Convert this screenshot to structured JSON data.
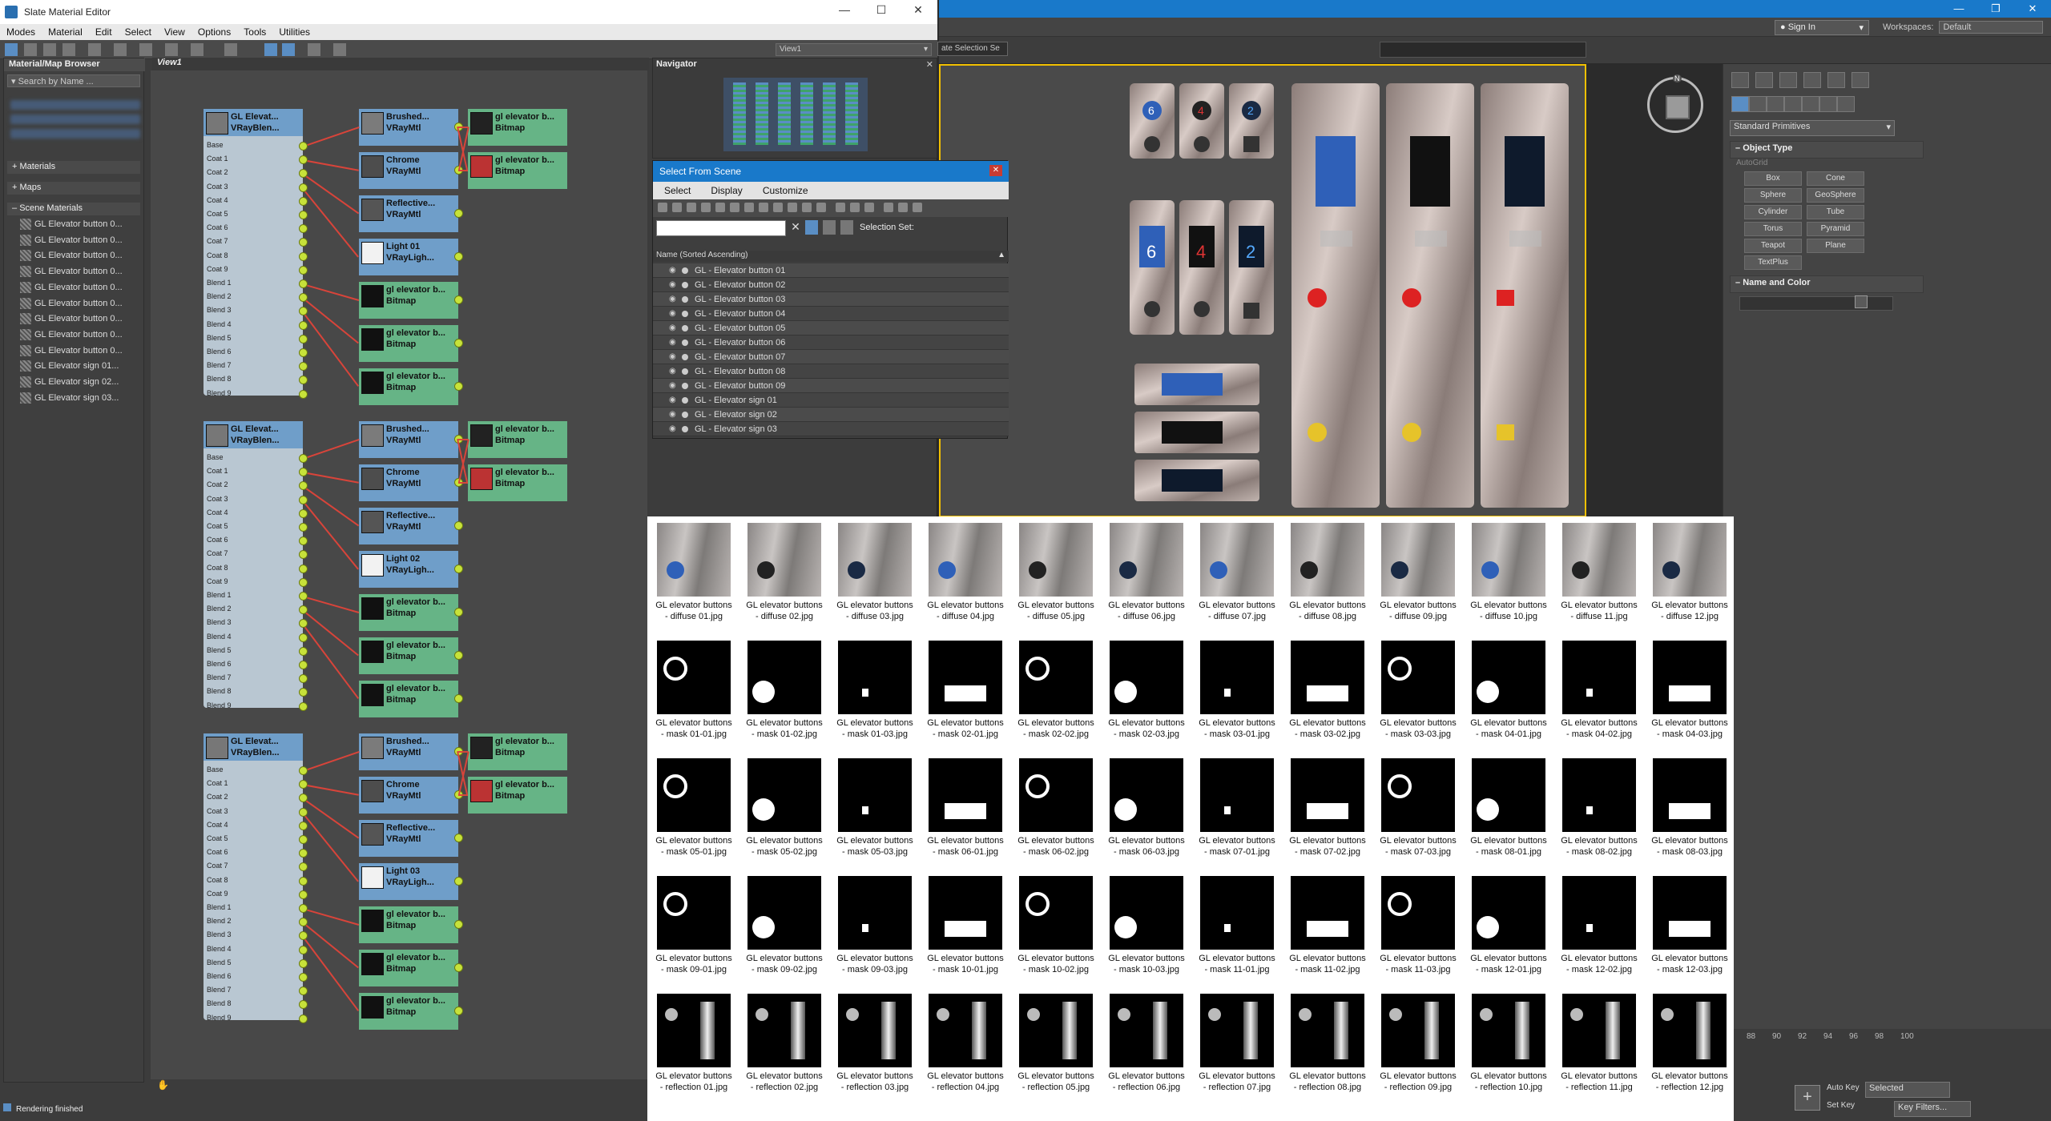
{
  "slate": {
    "title": "Slate Material Editor",
    "menu": [
      "Modes",
      "Material",
      "Edit",
      "Select",
      "View",
      "Options",
      "Tools",
      "Utilities"
    ],
    "view_dropdown": "View1",
    "browser": {
      "title": "Material/Map Browser",
      "search_placeholder": "Search by Name ...",
      "categories": [
        "Materials",
        "Maps",
        "Scene Materials"
      ],
      "scene_materials": [
        "GL Elevator button 0...",
        "GL Elevator button 0...",
        "GL Elevator button 0...",
        "GL Elevator button 0...",
        "GL Elevator button 0...",
        "GL Elevator button 0...",
        "GL Elevator button 0...",
        "GL Elevator button 0...",
        "GL Elevator button 0...",
        "GL Elevator sign 01...",
        "GL Elevator sign 02...",
        "GL Elevator sign 03..."
      ]
    },
    "view_tab": "View1",
    "slots": [
      "Base",
      "Coat 1",
      "Coat 2",
      "Coat 3",
      "Coat 4",
      "Coat 5",
      "Coat 6",
      "Coat 7",
      "Coat 8",
      "Coat 9",
      "Blend 1",
      "Blend 2",
      "Blend 3",
      "Blend 4",
      "Blend 5",
      "Blend 6",
      "Blend 7",
      "Blend 8",
      "Blend 9"
    ],
    "groups": [
      {
        "main": {
          "t1": "GL Elevat...",
          "t2": "VRayBlen..."
        },
        "mtls": [
          {
            "t1": "Brushed...",
            "t2": "VRayMtl"
          },
          {
            "t1": "Chrome",
            "t2": "VRayMtl"
          },
          {
            "t1": "Reflective...",
            "t2": "VRayMtl"
          },
          {
            "t1": "Light 01",
            "t2": "VRayLigh..."
          },
          {
            "t1": "gl elevator b...",
            "t2": "Bitmap"
          },
          {
            "t1": "gl elevator b...",
            "t2": "Bitmap"
          },
          {
            "t1": "gl elevator b...",
            "t2": "Bitmap"
          }
        ],
        "bitmaps": [
          {
            "t1": "gl elevator b...",
            "t2": "Bitmap"
          },
          {
            "t1": "gl elevator b...",
            "t2": "Bitmap"
          }
        ]
      },
      {
        "main": {
          "t1": "GL Elevat...",
          "t2": "VRayBlen..."
        },
        "mtls": [
          {
            "t1": "Brushed...",
            "t2": "VRayMtl"
          },
          {
            "t1": "Chrome",
            "t2": "VRayMtl"
          },
          {
            "t1": "Reflective...",
            "t2": "VRayMtl"
          },
          {
            "t1": "Light 02",
            "t2": "VRayLigh..."
          },
          {
            "t1": "gl elevator b...",
            "t2": "Bitmap"
          },
          {
            "t1": "gl elevator b...",
            "t2": "Bitmap"
          },
          {
            "t1": "gl elevator b...",
            "t2": "Bitmap"
          }
        ],
        "bitmaps": [
          {
            "t1": "gl elevator b...",
            "t2": "Bitmap"
          },
          {
            "t1": "gl elevator b...",
            "t2": "Bitmap"
          }
        ]
      },
      {
        "main": {
          "t1": "GL Elevat...",
          "t2": "VRayBlen..."
        },
        "mtls": [
          {
            "t1": "Brushed...",
            "t2": "VRayMtl"
          },
          {
            "t1": "Chrome",
            "t2": "VRayMtl"
          },
          {
            "t1": "Reflective...",
            "t2": "VRayMtl"
          },
          {
            "t1": "Light 03",
            "t2": "VRayLigh..."
          },
          {
            "t1": "gl elevator b...",
            "t2": "Bitmap"
          },
          {
            "t1": "gl elevator b...",
            "t2": "Bitmap"
          },
          {
            "t1": "gl elevator b...",
            "t2": "Bitmap"
          }
        ],
        "bitmaps": [
          {
            "t1": "gl elevator b...",
            "t2": "Bitmap"
          },
          {
            "t1": "gl elevator b...",
            "t2": "Bitmap"
          }
        ]
      }
    ],
    "status": "Rendering finished"
  },
  "navigator": {
    "title": "Navigator"
  },
  "select_from_scene": {
    "title": "Select From Scene",
    "menu": [
      "Select",
      "Display",
      "Customize"
    ],
    "selection_set_label": "Selection Set:",
    "column_header": "Name (Sorted Ascending)",
    "rows": [
      "GL - Elevator button 01",
      "GL - Elevator button 02",
      "GL - Elevator button 03",
      "GL - Elevator button 04",
      "GL - Elevator button 05",
      "GL - Elevator button 06",
      "GL - Elevator button 07",
      "GL - Elevator button 08",
      "GL - Elevator button 09",
      "GL - Elevator sign 01",
      "GL - Elevator sign 02",
      "GL - Elevator sign 03"
    ]
  },
  "max": {
    "sign_in": "Sign In",
    "workspaces_label": "Workspaces:",
    "workspaces_value": "Default",
    "selection_set": "ate Selection Se",
    "primitive_dropdown": "Standard Primitives",
    "object_type_title": "Object Type",
    "autogrid": "AutoGrid",
    "object_types": [
      "Box",
      "Cone",
      "Sphere",
      "GeoSphere",
      "Cylinder",
      "Tube",
      "Torus",
      "Pyramid",
      "Teapot",
      "Plane",
      "TextPlus"
    ],
    "name_color_title": "Name and Color",
    "timeline_ticks": [
      "88",
      "90",
      "92",
      "94",
      "96",
      "98",
      "100"
    ],
    "auto_key": "Auto Key",
    "set_key": "Set Key",
    "selected": "Selected",
    "key_filters": "Key Filters...",
    "viewcube_label": "N"
  },
  "textures": [
    [
      "GL elevator buttons - diffuse 01.jpg",
      "GL elevator buttons - diffuse 02.jpg",
      "GL elevator buttons - diffuse 03.jpg",
      "GL elevator buttons - diffuse 04.jpg",
      "GL elevator buttons - diffuse 05.jpg",
      "GL elevator buttons - diffuse 06.jpg",
      "GL elevator buttons - diffuse 07.jpg",
      "GL elevator buttons - diffuse 08.jpg",
      "GL elevator buttons - diffuse 09.jpg",
      "GL elevator buttons - diffuse 10.jpg",
      "GL elevator buttons - diffuse 11.jpg",
      "GL elevator buttons - diffuse 12.jpg"
    ],
    [
      "GL elevator buttons - mask 01-01.jpg",
      "GL elevator buttons - mask 01-02.jpg",
      "GL elevator buttons - mask 01-03.jpg",
      "GL elevator buttons - mask 02-01.jpg",
      "GL elevator buttons - mask 02-02.jpg",
      "GL elevator buttons - mask 02-03.jpg",
      "GL elevator buttons - mask 03-01.jpg",
      "GL elevator buttons - mask 03-02.jpg",
      "GL elevator buttons - mask 03-03.jpg",
      "GL elevator buttons - mask 04-01.jpg",
      "GL elevator buttons - mask 04-02.jpg",
      "GL elevator buttons - mask 04-03.jpg"
    ],
    [
      "GL elevator buttons - mask 05-01.jpg",
      "GL elevator buttons - mask 05-02.jpg",
      "GL elevator buttons - mask 05-03.jpg",
      "GL elevator buttons - mask 06-01.jpg",
      "GL elevator buttons - mask 06-02.jpg",
      "GL elevator buttons - mask 06-03.jpg",
      "GL elevator buttons - mask 07-01.jpg",
      "GL elevator buttons - mask 07-02.jpg",
      "GL elevator buttons - mask 07-03.jpg",
      "GL elevator buttons - mask 08-01.jpg",
      "GL elevator buttons - mask 08-02.jpg",
      "GL elevator buttons - mask 08-03.jpg"
    ],
    [
      "GL elevator buttons - mask 09-01.jpg",
      "GL elevator buttons - mask 09-02.jpg",
      "GL elevator buttons - mask 09-03.jpg",
      "GL elevator buttons - mask 10-01.jpg",
      "GL elevator buttons - mask 10-02.jpg",
      "GL elevator buttons - mask 10-03.jpg",
      "GL elevator buttons - mask 11-01.jpg",
      "GL elevator buttons - mask 11-02.jpg",
      "GL elevator buttons - mask 11-03.jpg",
      "GL elevator buttons - mask 12-01.jpg",
      "GL elevator buttons - mask 12-02.jpg",
      "GL elevator buttons - mask 12-03.jpg"
    ],
    [
      "GL elevator buttons - reflection 01.jpg",
      "GL elevator buttons - reflection 02.jpg",
      "GL elevator buttons - reflection 03.jpg",
      "GL elevator buttons - reflection 04.jpg",
      "GL elevator buttons - reflection 05.jpg",
      "GL elevator buttons - reflection 06.jpg",
      "GL elevator buttons - reflection 07.jpg",
      "GL elevator buttons - reflection 08.jpg",
      "GL elevator buttons - reflection 09.jpg",
      "GL elevator buttons - reflection 10.jpg",
      "GL elevator buttons - reflection 11.jpg",
      "GL elevator buttons - reflection 12.jpg"
    ]
  ],
  "colors": {
    "accent_blue": "#1979ca",
    "node_blue": "#6f9ec9",
    "bitmap_green": "#66b486",
    "wire_red": "#d8443a",
    "socket_yellow": "#c7e23a",
    "viewport_border": "#f2c000"
  }
}
